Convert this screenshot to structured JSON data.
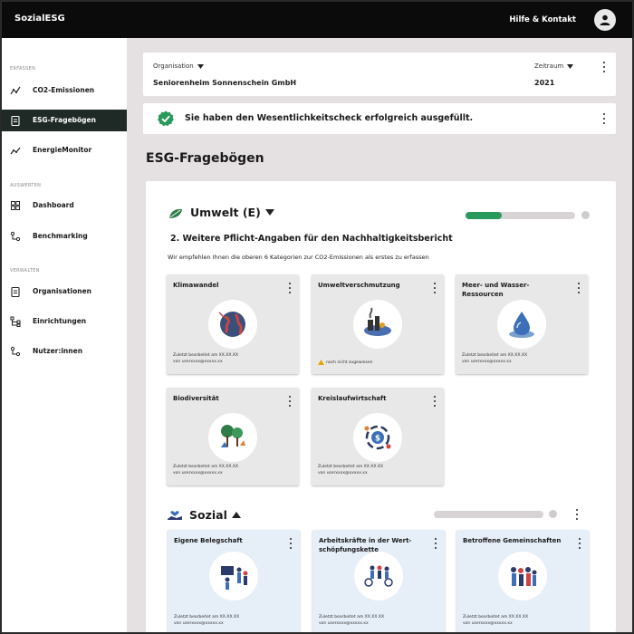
{
  "app": {
    "brand": "SozialESG",
    "help_label": "Hilfe & Kontakt"
  },
  "sidebar": {
    "sections": [
      {
        "label": "ERFASSEN"
      },
      {
        "label": "AUSWERTEN"
      },
      {
        "label": "VERWALTEN"
      }
    ],
    "items": [
      {
        "label": "CO2-Emissionen"
      },
      {
        "label": "ESG-Fragebögen"
      },
      {
        "label": "EnergieMonitor"
      },
      {
        "label": "Dashboard"
      },
      {
        "label": "Benchmarking"
      },
      {
        "label": "Organisationen"
      },
      {
        "label": "Einrichtungen"
      },
      {
        "label": "Nutzer:innen"
      }
    ]
  },
  "header": {
    "org_label": "Organisation",
    "org_value": "Seniorenheim Sonnenschein GmbH",
    "period_label": "Zeitraum",
    "period_value": "2021"
  },
  "notice": {
    "text": "Sie haben den Wesentlichkeitscheck erfolgreich ausgefüllt."
  },
  "main": {
    "title": "ESG-Fragebögen",
    "umwelt": {
      "title": "Umwelt (E)",
      "progress": 0.33,
      "subtitle": "2. Weitere Pflicht-Angaben für den Nachhaltigkeitsbericht",
      "hint": "Wir empfehlen Ihnen die oberen 6 Kategorien zur CO2-Emissionen als erstes zu erfassen",
      "tiles": [
        {
          "title": "Klimawandel",
          "meta1": "Zuletzt bearbeitet am XX.XX.XX",
          "meta2": "von userxxxx@xxxxx.xx"
        },
        {
          "title": "Umweltverschmutzung",
          "warning": "noch nicht zugewiesen"
        },
        {
          "title": "Meer- und Wasser-Ressourcen",
          "meta1": "Zuletzt bearbeitet am XX.XX.XX",
          "meta2": "von userxxxx@xxxxx.xx"
        },
        {
          "title": "Biodiversität",
          "meta1": "Zuletzt bearbeitet am XX.XX.XX",
          "meta2": "von userxxxx@xxxxx.xx"
        },
        {
          "title": "Kreislaufwirtschaft",
          "meta1": "Zuletzt bearbeitet am XX.XX.XX",
          "meta2": "von userxxxx@xxxxx.xx"
        }
      ]
    },
    "sozial": {
      "title": "Sozial",
      "progress": 0,
      "tiles": [
        {
          "title": "Eigene Belegschaft",
          "meta1": "Zuletzt bearbeitet am XX.XX.XX",
          "meta2": "von userxxxx@xxxxx.xx"
        },
        {
          "title": "Arbeitskräfte in der Wert-schöpfungskette",
          "meta1": "Zuletzt bearbeitet am XX.XX.XX",
          "meta2": "von userxxxx@xxxxx.xx"
        },
        {
          "title": "Betroffene Gemeinschaften",
          "meta1": "Zuletzt bearbeitet am XX.XX.XX",
          "meta2": "von userxxxx@xxxxx.xx"
        }
      ]
    }
  },
  "colors": {
    "accent_green": "#2a9a5c",
    "dark": "#1f2a27",
    "topbar": "#0b0b0b",
    "background": "#e5e0e2"
  }
}
